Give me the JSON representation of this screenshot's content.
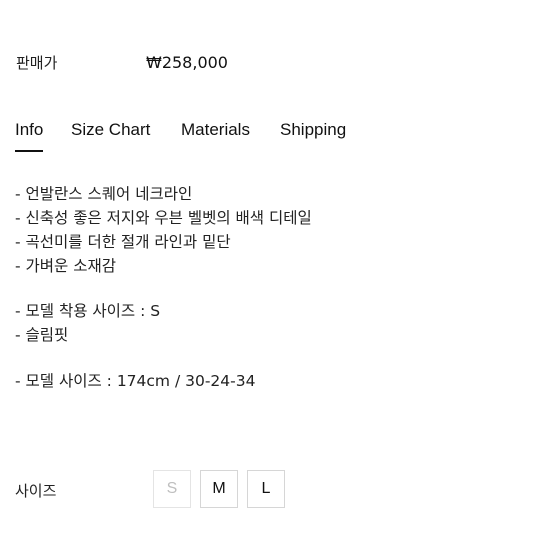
{
  "product": {
    "price_label": "판매가",
    "price": "₩258,000"
  },
  "tabs": [
    {
      "label": "Info",
      "active": true
    },
    {
      "label": "Size Chart",
      "active": false
    },
    {
      "label": "Materials",
      "active": false
    },
    {
      "label": "Shipping",
      "active": false
    }
  ],
  "description": {
    "lines": [
      "- 언발란스 스퀘어 네크라인",
      "- 신축성 좋은 저지와 우븐 벨벳의 배색 디테일",
      "- 곡선미를 더한 절개 라인과 밑단",
      "- 가벼운 소재감",
      "- 모델 착용 사이즈 : S",
      "- 슬림핏",
      "- 모델 사이즈 : 174cm / 30-24-34"
    ]
  },
  "size_selector": {
    "label": "사이즈",
    "options": [
      {
        "label": "S",
        "available": false
      },
      {
        "label": "M",
        "available": true
      },
      {
        "label": "L",
        "available": true
      }
    ]
  }
}
